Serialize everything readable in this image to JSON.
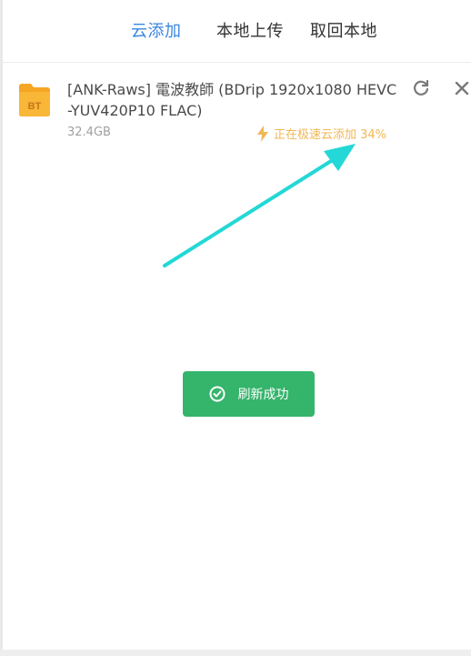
{
  "tabs": [
    {
      "label": "云添加"
    },
    {
      "label": "本地上传"
    },
    {
      "label": "取回本地"
    }
  ],
  "task": {
    "file_icon_label": "BT",
    "name": "[ANK-Raws] 電波教師 (BDrip 1920x1080 HEVC -YUV420P10 FLAC)",
    "size": "32.4GB",
    "status": "正在极速云添加 34%",
    "progress_percent": 34
  },
  "toast": {
    "message": "刷新成功"
  },
  "colors": {
    "accent": "#3a86e0",
    "status": "#f1b755",
    "success": "#35b46c",
    "annotation_arrow": "#23d8d6"
  }
}
